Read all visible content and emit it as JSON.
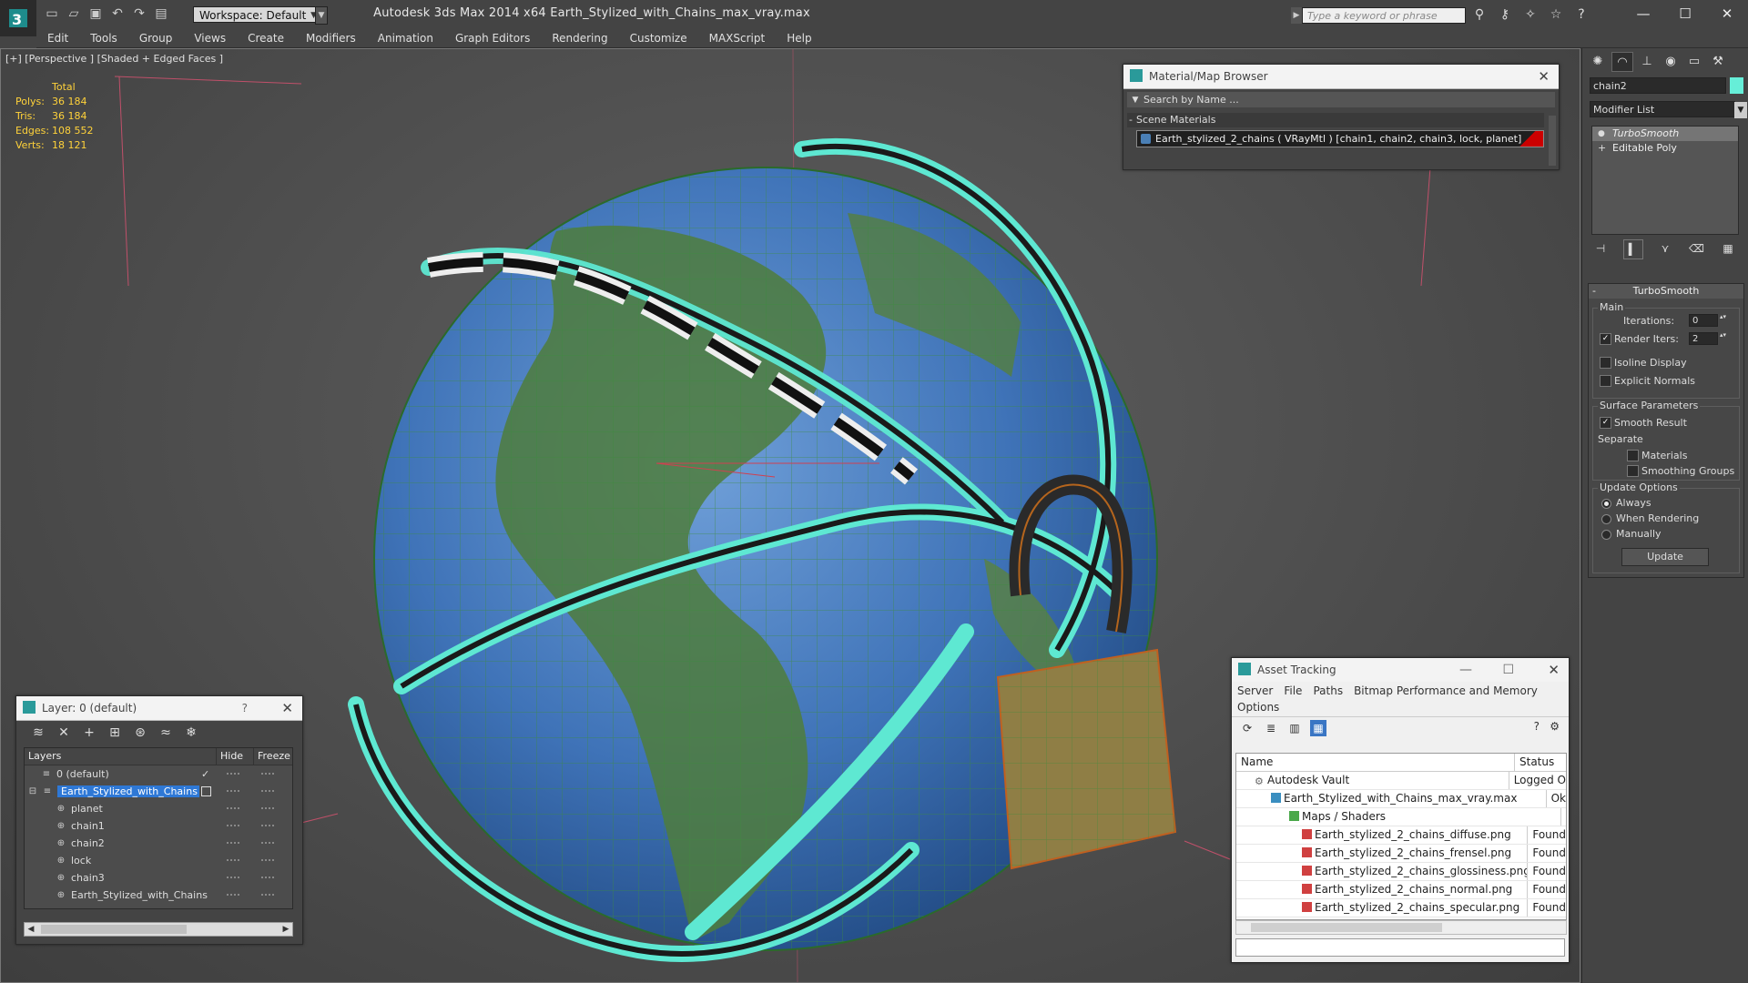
{
  "window": {
    "title": "Autodesk 3ds Max  2014 x64      Earth_Stylized_with_Chains_max_vray.max",
    "workspace": "Workspace: Default",
    "search_placeholder": "Type a keyword or phrase"
  },
  "menu": [
    "Edit",
    "Tools",
    "Group",
    "Views",
    "Create",
    "Modifiers",
    "Animation",
    "Graph Editors",
    "Rendering",
    "Customize",
    "MAXScript",
    "Help"
  ],
  "viewport": {
    "label": "[+] [Perspective ] [Shaded + Edged Faces ]",
    "stats": {
      "header": "Total",
      "rows": [
        {
          "k": "Polys:",
          "v": "36 184"
        },
        {
          "k": "Tris:",
          "v": "36 184"
        },
        {
          "k": "Edges:",
          "v": "108 552"
        },
        {
          "k": "Verts:",
          "v": "18 121"
        }
      ]
    }
  },
  "material_browser": {
    "title": "Material/Map Browser",
    "search": "Search by Name ...",
    "section": "Scene Materials",
    "item": "Earth_stylized_2_chains  ( VRayMtl ) [chain1, chain2, chain3, lock, planet]"
  },
  "command_panel": {
    "object_name": "chain2",
    "object_color": "#66eed8",
    "modifier_list": "Modifier List",
    "stack": [
      "TurboSmooth",
      "Editable Poly"
    ],
    "turbosmooth": {
      "title": "TurboSmooth",
      "main": "Main",
      "iterations_label": "Iterations:",
      "iterations": "0",
      "render_iters_label": "Render Iters:",
      "render_iters": "2",
      "isoline": "Isoline Display",
      "explicit": "Explicit Normals",
      "surface": "Surface Parameters",
      "smooth_result": "Smooth Result",
      "separate": "Separate",
      "materials": "Materials",
      "smoothing_groups": "Smoothing Groups",
      "update_options": "Update Options",
      "always": "Always",
      "when_rendering": "When Rendering",
      "manually": "Manually",
      "update": "Update"
    }
  },
  "layer_explorer": {
    "title": "Layer: 0 (default)",
    "columns": [
      "Layers",
      "Hide",
      "Freeze"
    ],
    "rows": [
      "0 (default)",
      "Earth_Stylized_with_Chains",
      "planet",
      "chain1",
      "chain2",
      "lock",
      "chain3",
      "Earth_Stylized_with_Chains"
    ]
  },
  "asset_tracking": {
    "title": "Asset Tracking",
    "menu": [
      "Server",
      "File",
      "Paths",
      "Bitmap Performance and Memory"
    ],
    "menu2": "Options",
    "columns": [
      "Name",
      "Status"
    ],
    "rows": [
      {
        "name": "Autodesk Vault",
        "status": "Logged O"
      },
      {
        "name": "Earth_Stylized_with_Chains_max_vray.max",
        "status": "Ok"
      },
      {
        "name": "Maps / Shaders",
        "status": ""
      },
      {
        "name": "Earth_stylized_2_chains_diffuse.png",
        "status": "Found"
      },
      {
        "name": "Earth_stylized_2_chains_frensel.png",
        "status": "Found"
      },
      {
        "name": "Earth_stylized_2_chains_glossiness.png",
        "status": "Found"
      },
      {
        "name": "Earth_stylized_2_chains_normal.png",
        "status": "Found"
      },
      {
        "name": "Earth_stylized_2_chains_specular.png",
        "status": "Found"
      }
    ]
  }
}
